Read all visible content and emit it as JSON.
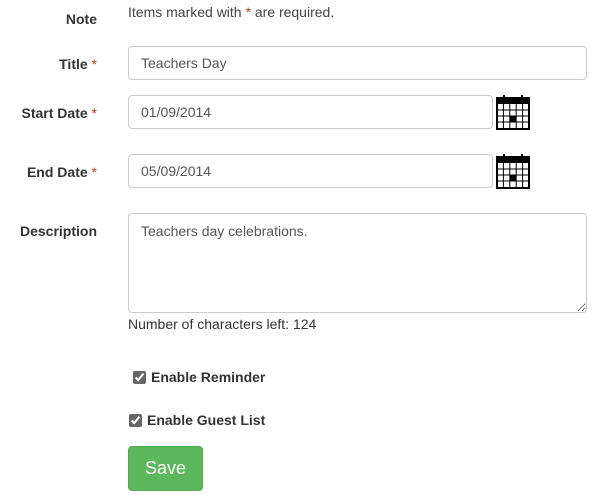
{
  "note": {
    "label": "Note",
    "text_before": "Items marked with ",
    "asterisk": "*",
    "text_after": " are required."
  },
  "title_field": {
    "label": "Title",
    "required_mark": "*",
    "value": "Teachers Day"
  },
  "start_date": {
    "label": "Start Date",
    "required_mark": "*",
    "value": "01/09/2014",
    "icon": "calendar-icon"
  },
  "end_date": {
    "label": "End Date",
    "required_mark": "*",
    "value": "05/09/2014",
    "icon": "calendar-icon"
  },
  "description": {
    "label": "Description",
    "value": "Teachers day celebrations.",
    "counter_text": "Number of characters left: 124"
  },
  "reminder": {
    "label": "Enable Reminder",
    "checked": true
  },
  "guest_list": {
    "label": "Enable Guest List",
    "checked": true
  },
  "save_button": {
    "label": "Save"
  },
  "colors": {
    "required": "#c0392b",
    "save_button": "#5cb85c",
    "input_border": "#cccccc"
  }
}
